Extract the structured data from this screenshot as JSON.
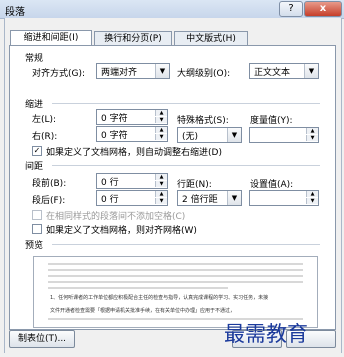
{
  "window": {
    "title": "段落",
    "help_label": "?",
    "close_label": "x"
  },
  "tabs": [
    {
      "label": "缩进和间距(I)"
    },
    {
      "label": "换行和分页(P)"
    },
    {
      "label": "中文版式(H)"
    }
  ],
  "general": {
    "heading": "常规",
    "alignment_label": "对齐方式(G):",
    "alignment_value": "两端对齐",
    "outline_label": "大纲级别(O):",
    "outline_value": "正文文本"
  },
  "indent": {
    "heading": "缩进",
    "left_label": "左(L):",
    "left_value": "0 字符",
    "right_label": "右(R):",
    "right_value": "0 字符",
    "special_label": "特殊格式(S):",
    "special_value": "(无)",
    "by_label": "度量值(Y):",
    "by_value": "",
    "auto_adjust_label": "如果定义了文档网格，则自动调整右缩进(D)",
    "auto_adjust_checked": true
  },
  "spacing": {
    "heading": "间距",
    "before_label": "段前(B):",
    "before_value": "0 行",
    "after_label": "段后(F):",
    "after_value": "0 行",
    "line_label": "行距(N):",
    "line_value": "2 倍行距",
    "at_label": "设置值(A):",
    "at_value": "",
    "no_space_label": "在相同样式的段落间不添加空格(C)",
    "no_space_checked": false,
    "snap_grid_label": "如果定义了文档网格，则对齐网格(W)",
    "snap_grid_checked": false
  },
  "preview": {
    "heading": "预览",
    "sample_line_1": "1、任何听课者的工作单位都应积极配合主任的检查与指导，认真完成课程的学习、实习任务，未接",
    "sample_line_2": "文件开通者检查需要「根据申请机关批准手续，在有关单位中办理」应用于不通过，"
  },
  "footer": {
    "tabs_button_label": "制表位(T)..."
  },
  "watermark": "最需教育"
}
